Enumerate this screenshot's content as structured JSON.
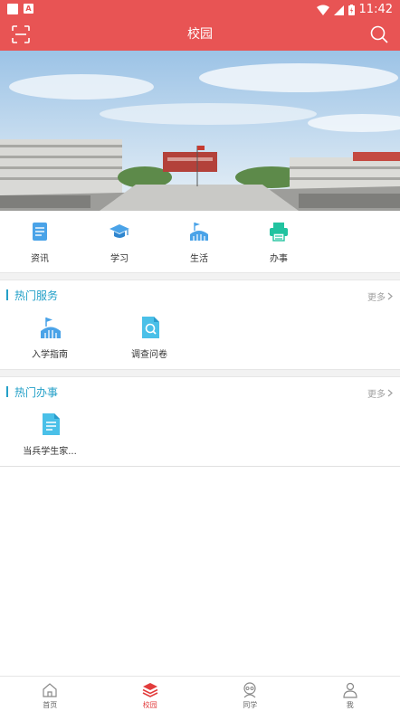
{
  "status_bar": {
    "time": "11:42"
  },
  "app_bar": {
    "title": "校园"
  },
  "quick_nav": [
    {
      "label": "资讯",
      "icon": "news-icon"
    },
    {
      "label": "学习",
      "icon": "graduation-cap-icon"
    },
    {
      "label": "生活",
      "icon": "stadium-icon"
    },
    {
      "label": "办事",
      "icon": "printer-icon"
    }
  ],
  "hot_services": {
    "title": "热门服务",
    "more": "更多",
    "items": [
      {
        "label": "入学指南",
        "icon": "stadium-icon"
      },
      {
        "label": "调查问卷",
        "icon": "search-document-icon"
      }
    ]
  },
  "hot_affairs": {
    "title": "热门办事",
    "more": "更多",
    "items": [
      {
        "label": "当兵学生家...",
        "icon": "document-icon"
      }
    ]
  },
  "tab_bar": [
    {
      "label": "首页",
      "icon": "home-icon",
      "active": false
    },
    {
      "label": "校园",
      "icon": "layers-icon",
      "active": true
    },
    {
      "label": "同学",
      "icon": "classmates-icon",
      "active": false
    },
    {
      "label": "我",
      "icon": "person-icon",
      "active": false
    }
  ],
  "colors": {
    "header_red": "#e85454",
    "accent_teal": "#24a0c8",
    "icon_blue": "#4aa3e8",
    "icon_green": "#22c3a0",
    "active_tab_red": "#e23c3c"
  }
}
